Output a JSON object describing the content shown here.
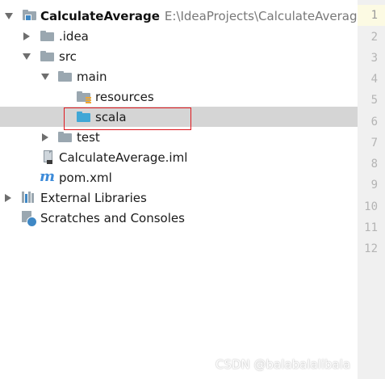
{
  "project_tree": {
    "root": {
      "label": "CalculateAverage",
      "path": "E:\\IdeaProjects\\CalculateAverage",
      "expanded": true
    },
    "items": [
      {
        "label": ".idea",
        "type": "folder",
        "expanded": false
      },
      {
        "label": "src",
        "type": "folder",
        "expanded": true
      },
      {
        "label": "main",
        "type": "folder",
        "expanded": true
      },
      {
        "label": "resources",
        "type": "resources-folder"
      },
      {
        "label": "scala",
        "type": "source-folder",
        "selected": true
      },
      {
        "label": "test",
        "type": "folder",
        "expanded": false
      },
      {
        "label": "CalculateAverage.iml",
        "type": "iml-file"
      },
      {
        "label": "pom.xml",
        "type": "maven-file"
      },
      {
        "label": "External Libraries",
        "type": "libraries",
        "expanded": false
      },
      {
        "label": "Scratches and Consoles",
        "type": "scratches"
      }
    ]
  },
  "editor": {
    "line_numbers": [
      "1",
      "2",
      "3",
      "4",
      "5",
      "6",
      "7",
      "8",
      "9",
      "10",
      "11",
      "12"
    ],
    "current_line": "1"
  },
  "watermark": "CSDN @balabalalibala",
  "colors": {
    "selection": "#d5d5d5",
    "highlight_border": "#e0191f",
    "source_folder": "#40a7d6",
    "folder": "#9aa7b0"
  }
}
